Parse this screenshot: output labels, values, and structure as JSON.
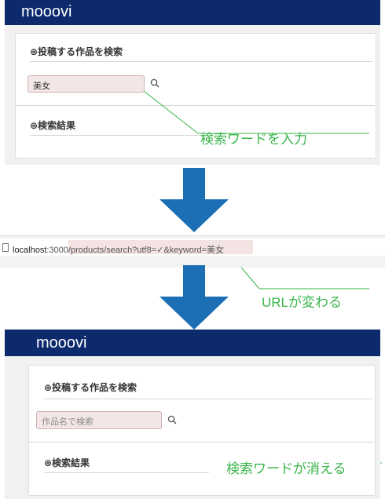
{
  "before": {
    "brand": "mooovi",
    "search_heading": "⊛投稿する作品を検索",
    "search_value": "美女",
    "results_heading": "⊛検索結果"
  },
  "url_bar": {
    "host": "localhost",
    "path": ":3000/products/search?utf8=✓&keyword=美女"
  },
  "after": {
    "brand": "mooovi",
    "search_heading": "⊛投稿する作品を検索",
    "search_placeholder": "作品名で検索",
    "results_heading": "⊛検索結果"
  },
  "annotations": {
    "enter_keyword": "検索ワードを入力",
    "url_changes": "URLが変わる",
    "keyword_cleared": "検索ワードが消える"
  },
  "colors": {
    "navbar": "#0d2a6d",
    "arrow": "#1d6fb5",
    "callout": "#39b54a",
    "highlight": "#f4e6e6"
  }
}
